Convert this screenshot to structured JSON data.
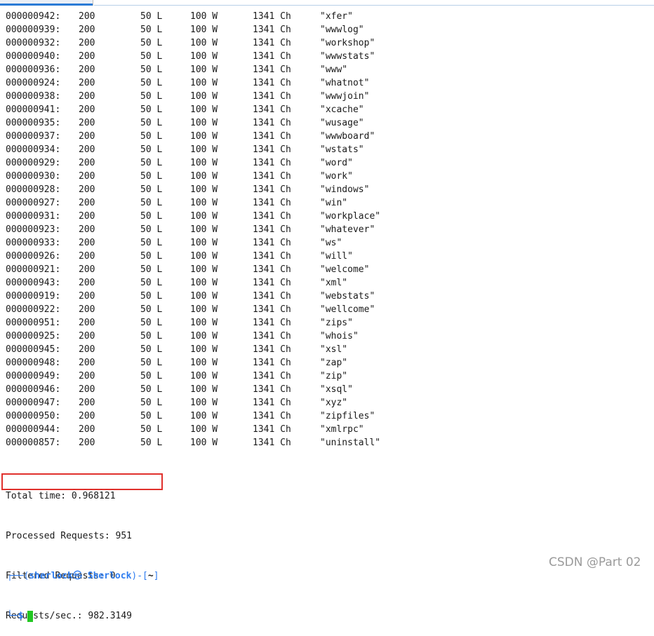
{
  "results": [
    {
      "id": "000000942:",
      "code": "200",
      "lines": "50 L",
      "words": "100 W",
      "chars": "1341 Ch",
      "payload": "\"xfer\""
    },
    {
      "id": "000000939:",
      "code": "200",
      "lines": "50 L",
      "words": "100 W",
      "chars": "1341 Ch",
      "payload": "\"wwwlog\""
    },
    {
      "id": "000000932:",
      "code": "200",
      "lines": "50 L",
      "words": "100 W",
      "chars": "1341 Ch",
      "payload": "\"workshop\""
    },
    {
      "id": "000000940:",
      "code": "200",
      "lines": "50 L",
      "words": "100 W",
      "chars": "1341 Ch",
      "payload": "\"wwwstats\""
    },
    {
      "id": "000000936:",
      "code": "200",
      "lines": "50 L",
      "words": "100 W",
      "chars": "1341 Ch",
      "payload": "\"www\""
    },
    {
      "id": "000000924:",
      "code": "200",
      "lines": "50 L",
      "words": "100 W",
      "chars": "1341 Ch",
      "payload": "\"whatnot\""
    },
    {
      "id": "000000938:",
      "code": "200",
      "lines": "50 L",
      "words": "100 W",
      "chars": "1341 Ch",
      "payload": "\"wwwjoin\""
    },
    {
      "id": "000000941:",
      "code": "200",
      "lines": "50 L",
      "words": "100 W",
      "chars": "1341 Ch",
      "payload": "\"xcache\""
    },
    {
      "id": "000000935:",
      "code": "200",
      "lines": "50 L",
      "words": "100 W",
      "chars": "1341 Ch",
      "payload": "\"wusage\""
    },
    {
      "id": "000000937:",
      "code": "200",
      "lines": "50 L",
      "words": "100 W",
      "chars": "1341 Ch",
      "payload": "\"wwwboard\""
    },
    {
      "id": "000000934:",
      "code": "200",
      "lines": "50 L",
      "words": "100 W",
      "chars": "1341 Ch",
      "payload": "\"wstats\""
    },
    {
      "id": "000000929:",
      "code": "200",
      "lines": "50 L",
      "words": "100 W",
      "chars": "1341 Ch",
      "payload": "\"word\""
    },
    {
      "id": "000000930:",
      "code": "200",
      "lines": "50 L",
      "words": "100 W",
      "chars": "1341 Ch",
      "payload": "\"work\""
    },
    {
      "id": "000000928:",
      "code": "200",
      "lines": "50 L",
      "words": "100 W",
      "chars": "1341 Ch",
      "payload": "\"windows\""
    },
    {
      "id": "000000927:",
      "code": "200",
      "lines": "50 L",
      "words": "100 W",
      "chars": "1341 Ch",
      "payload": "\"win\""
    },
    {
      "id": "000000931:",
      "code": "200",
      "lines": "50 L",
      "words": "100 W",
      "chars": "1341 Ch",
      "payload": "\"workplace\""
    },
    {
      "id": "000000923:",
      "code": "200",
      "lines": "50 L",
      "words": "100 W",
      "chars": "1341 Ch",
      "payload": "\"whatever\""
    },
    {
      "id": "000000933:",
      "code": "200",
      "lines": "50 L",
      "words": "100 W",
      "chars": "1341 Ch",
      "payload": "\"ws\""
    },
    {
      "id": "000000926:",
      "code": "200",
      "lines": "50 L",
      "words": "100 W",
      "chars": "1341 Ch",
      "payload": "\"will\""
    },
    {
      "id": "000000921:",
      "code": "200",
      "lines": "50 L",
      "words": "100 W",
      "chars": "1341 Ch",
      "payload": "\"welcome\""
    },
    {
      "id": "000000943:",
      "code": "200",
      "lines": "50 L",
      "words": "100 W",
      "chars": "1341 Ch",
      "payload": "\"xml\""
    },
    {
      "id": "000000919:",
      "code": "200",
      "lines": "50 L",
      "words": "100 W",
      "chars": "1341 Ch",
      "payload": "\"webstats\""
    },
    {
      "id": "000000922:",
      "code": "200",
      "lines": "50 L",
      "words": "100 W",
      "chars": "1341 Ch",
      "payload": "\"wellcome\""
    },
    {
      "id": "000000951:",
      "code": "200",
      "lines": "50 L",
      "words": "100 W",
      "chars": "1341 Ch",
      "payload": "\"zips\""
    },
    {
      "id": "000000925:",
      "code": "200",
      "lines": "50 L",
      "words": "100 W",
      "chars": "1341 Ch",
      "payload": "\"whois\""
    },
    {
      "id": "000000945:",
      "code": "200",
      "lines": "50 L",
      "words": "100 W",
      "chars": "1341 Ch",
      "payload": "\"xsl\""
    },
    {
      "id": "000000948:",
      "code": "200",
      "lines": "50 L",
      "words": "100 W",
      "chars": "1341 Ch",
      "payload": "\"zap\""
    },
    {
      "id": "000000949:",
      "code": "200",
      "lines": "50 L",
      "words": "100 W",
      "chars": "1341 Ch",
      "payload": "\"zip\""
    },
    {
      "id": "000000946:",
      "code": "200",
      "lines": "50 L",
      "words": "100 W",
      "chars": "1341 Ch",
      "payload": "\"xsql\""
    },
    {
      "id": "000000947:",
      "code": "200",
      "lines": "50 L",
      "words": "100 W",
      "chars": "1341 Ch",
      "payload": "\"xyz\""
    },
    {
      "id": "000000950:",
      "code": "200",
      "lines": "50 L",
      "words": "100 W",
      "chars": "1341 Ch",
      "payload": "\"zipfiles\""
    },
    {
      "id": "000000944:",
      "code": "200",
      "lines": "50 L",
      "words": "100 W",
      "chars": "1341 Ch",
      "payload": "\"xmlrpc\""
    },
    {
      "id": "000000857:",
      "code": "200",
      "lines": "50 L",
      "words": "100 W",
      "chars": "1341 Ch",
      "payload": "\"uninstall\""
    }
  ],
  "summary": {
    "total_time": "Total time: 0.968121",
    "processed": "Processed Requests: 951",
    "filtered": "Filtered Requests: 0",
    "rate": "Requests/sec.: 982.3149"
  },
  "prompt": {
    "corner_top": "┌──",
    "open_paren": "(",
    "user": "sherlock",
    "skull": "㉿",
    "host": "Sherlock",
    "close_dash": ")-[",
    "dir": "~",
    "close_bracket": "]",
    "corner_bottom": "└─",
    "dollar": "$"
  },
  "watermark": "CSDN @Part 02",
  "colors": {
    "highlight_box": "#e0302c",
    "prompt_accent": "#2f7df0",
    "cursor": "#22c722"
  }
}
